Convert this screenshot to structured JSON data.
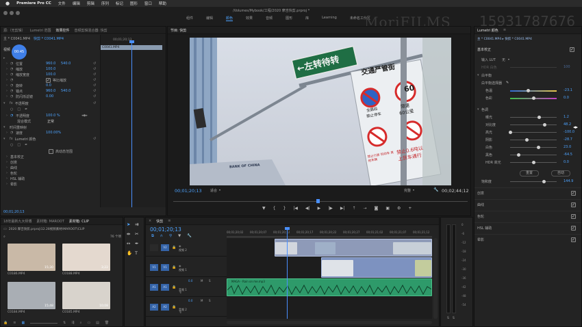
{
  "menubar": {
    "app_name": "Premiere Pro CC",
    "menus": [
      "文件",
      "编辑",
      "剪辑",
      "序列",
      "标记",
      "图形",
      "窗口",
      "帮助"
    ],
    "document_title": "/Volumes/Mybook/工程/2020 摩吉快剪.prproj *"
  },
  "workspaces": [
    "组件",
    "编辑",
    "颜色",
    "效果",
    "音频",
    "图形",
    "库",
    "Learning",
    "未命名工作区"
  ],
  "workspace_active": "颜色",
  "watermark": {
    "brand": "MoriFILMS",
    "phone": "15931787676"
  },
  "effect_controls": {
    "tabs": [
      "源:（无剪辑）",
      "Lumetri 范围",
      "效果控件",
      "音频剪辑混合器: 快剪"
    ],
    "active_tab": "效果控件",
    "header_master": "主 * C0041.MP4",
    "header_clip": "快剪 * C0041.MP4",
    "section_video": "视频",
    "timecode_left": "00;01;20;13",
    "timecode_right": "00;01;20;13",
    "clip_bar_label": "C0041.MP4",
    "params": [
      {
        "label": "位置",
        "value": "960.0",
        "value2": "540.0"
      },
      {
        "label": "缩放",
        "value": "100.0"
      },
      {
        "label": "缩放宽度",
        "value": "100.0"
      },
      {
        "label": "等比缩放",
        "value": ""
      },
      {
        "label": "旋转",
        "value": "0.0"
      },
      {
        "label": "锚点",
        "value": "960.0",
        "value2": "540.0"
      },
      {
        "label": "防闪烁滤镜",
        "value": "0.00"
      }
    ],
    "opacity": {
      "label": "不透明度",
      "value": "100.0 %",
      "blend_label": "混合模式",
      "blend_value": "正常"
    },
    "time_remap": {
      "label": "时间重映射",
      "speed_label": "速度",
      "speed_value": "100.00%"
    },
    "lumetri": {
      "label": "Lumetri 颜色",
      "hdr_label": "高动态范围",
      "items": [
        "基本校正",
        "创意",
        "曲线",
        "色轮",
        "HSL 辅助",
        "晕影"
      ]
    },
    "footer_timecode": "00;01;20;13"
  },
  "program": {
    "tabs": [
      "节目: 快剪"
    ],
    "signs": {
      "direction": "←左转待转",
      "banner": "交通严管街",
      "speed_limit": "60",
      "limit_label": "限速",
      "limit_unit": "60公里",
      "no_stop_1": "全路段",
      "no_stop_2": "禁止停车",
      "note_1": "禁止0.6吨以",
      "note_2": "上货车通行",
      "note_3": "禁止行驶 机动车 其他车辆",
      "bank": "BANK OF CHINA"
    },
    "timecode_current": "00;01;20;13",
    "fit": "适合",
    "quality": "完整",
    "timecode_duration": "00;02;44;12",
    "playhead_progress": 0.49
  },
  "project": {
    "tabs": [
      "18年最新九大师傅",
      "素材箱: MAROOT",
      "素材箱: CLIP"
    ],
    "active_tab": "素材箱: CLIP",
    "path": "2020 摩吉快剪.prproj\\12.28视频素材\\MAROOT\\CLIP",
    "count": "76 个项",
    "items": [
      {
        "name": "C0186.MP4",
        "duration": "15;30"
      },
      {
        "name": "C0188.MP4",
        "duration": "3;22"
      },
      {
        "name": "C0184.MP4",
        "duration": "15;48"
      },
      {
        "name": "C0185.MP4",
        "duration": "10;08"
      }
    ]
  },
  "timeline": {
    "tab": "快剪",
    "timecode": "00;01;20;13",
    "ruler": [
      "00;01;20;02",
      "00;01;20;07",
      "00;01;20;12",
      "00;01;20;17",
      "00;01;20;22",
      "00;01;20;27",
      "00;01;21;02",
      "00;01;21;07",
      "00;01;21;12"
    ],
    "tracks": [
      {
        "id": "V2",
        "name": "视频 2"
      },
      {
        "id": "V1",
        "name": "视频 1"
      },
      {
        "id": "A1",
        "name": "音频 1",
        "volume": "0.0",
        "m": "M",
        "s": "S"
      },
      {
        "id": "A2",
        "name": "音频 2",
        "volume": "0.0",
        "m": "M",
        "s": "S"
      }
    ],
    "audio_clip_label": "MAGA - Rain on me.mp3",
    "meter_labels": [
      "0",
      "-6",
      "-12",
      "-18",
      "-24",
      "-30",
      "-36",
      "-42",
      "-48",
      "-54"
    ]
  },
  "lumetri_panel": {
    "tab": "Lumetri 颜色",
    "header": "主 * C0041.MP4  ▸  快剪 * C0041.MP4",
    "basic": "基本校正",
    "input_lut_label": "输入 LUT",
    "input_lut_value": "无",
    "hdr_white_label": "HDR 白色",
    "hdr_white_value": "100",
    "wb_label": "白平衡",
    "wb_picker_label": "白平衡选择器",
    "temp_label": "色温",
    "temp_value": "-23.1",
    "tint_label": "色彩",
    "tint_value": "0.0",
    "tone_label": "色调",
    "tone": [
      {
        "label": "曝光",
        "value": "1.2"
      },
      {
        "label": "对比度",
        "value": "48.2"
      },
      {
        "label": "高光",
        "value": "-100.0"
      },
      {
        "label": "阴影",
        "value": "-28.7"
      },
      {
        "label": "白色",
        "value": "23.0"
      },
      {
        "label": "黑色",
        "value": "-64.5"
      },
      {
        "label": "HDR 高光",
        "value": "0.0"
      }
    ],
    "reset_label": "重置",
    "auto_label": "自动",
    "saturation_label": "饱和度",
    "saturation_value": "144.9",
    "sections": [
      "创意",
      "曲线",
      "色轮",
      "HSL 辅助",
      "晕影"
    ]
  }
}
